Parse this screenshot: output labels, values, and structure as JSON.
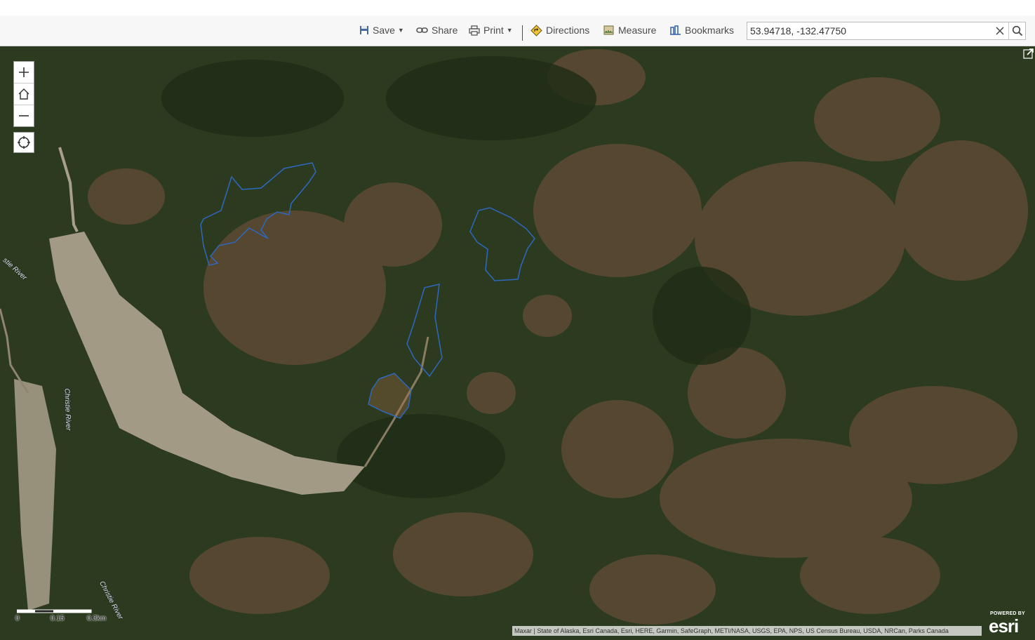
{
  "toolbar": {
    "save_label": "Save",
    "share_label": "Share",
    "print_label": "Print",
    "directions_label": "Directions",
    "measure_label": "Measure",
    "bookmarks_label": "Bookmarks"
  },
  "search": {
    "value": "53.94718, -132.47750"
  },
  "map": {
    "river_labels": [
      "stie River",
      "Christie River",
      "Christie River"
    ],
    "scale_labels": [
      "0",
      "0.15",
      "0.3km"
    ],
    "attribution": "Maxar | State of Alaska, Esri Canada, Esri, HERE, Garmin, SafeGraph, METI/NASA, USGS, EPA, NPS, US Census Bureau, USDA, NRCan, Parks Canada",
    "logo_small": "POWERED BY",
    "logo_big": "esri"
  },
  "colors": {
    "polygon_outline": "#2e68c0",
    "forest": "#2c3a1f",
    "clearing": "#5a4a32",
    "logged": "#a39a85"
  },
  "icons": [
    "save-icon",
    "share-icon",
    "print-icon",
    "directions-icon",
    "measure-icon",
    "bookmarks-icon",
    "clear-icon",
    "search-icon",
    "zoom-in-icon",
    "home-icon",
    "zoom-out-icon",
    "locate-icon",
    "expand-icon"
  ]
}
